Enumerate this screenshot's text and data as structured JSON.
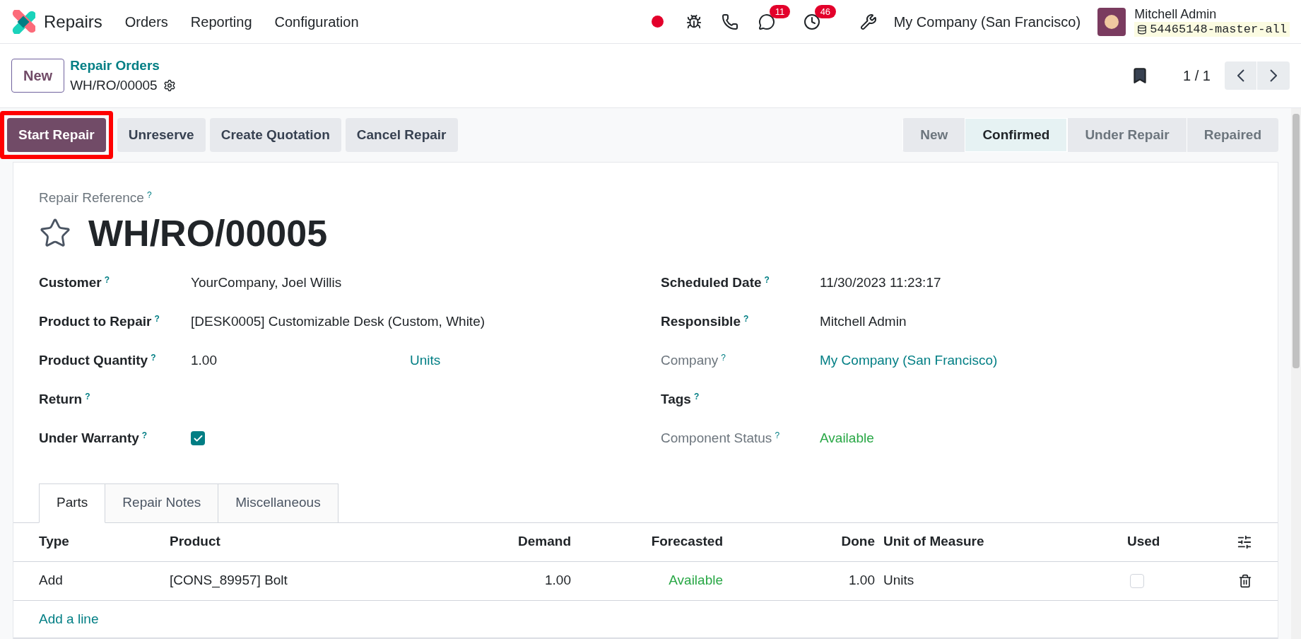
{
  "navbar": {
    "app_name": "Repairs",
    "menu": [
      "Orders",
      "Reporting",
      "Configuration"
    ],
    "badges": {
      "messages": "11",
      "activities": "46"
    },
    "company": "My Company (San Francisco)",
    "user": "Mitchell Admin",
    "database": "54465148-master-all"
  },
  "control_panel": {
    "new_button": "New",
    "breadcrumb": "Repair Orders",
    "record": "WH/RO/00005",
    "pager": "1 / 1"
  },
  "actions": [
    {
      "label": "Start Repair",
      "primary": true,
      "highlighted": true
    },
    {
      "label": "Unreserve",
      "primary": false,
      "highlighted": false
    },
    {
      "label": "Create Quotation",
      "primary": false,
      "highlighted": false
    },
    {
      "label": "Cancel Repair",
      "primary": false,
      "highlighted": false
    }
  ],
  "statusbar": [
    {
      "label": "New",
      "selected": false
    },
    {
      "label": "Confirmed",
      "selected": true
    },
    {
      "label": "Under Repair",
      "selected": false
    },
    {
      "label": "Repaired",
      "selected": false
    }
  ],
  "form": {
    "reference_label": "Repair Reference",
    "help": "?",
    "title": "WH/RO/00005",
    "starred": false,
    "left_fields": [
      {
        "label": "Customer",
        "kind": "text",
        "value": "YourCompany, Joel Willis",
        "muted": false
      },
      {
        "label": "Product to Repair",
        "kind": "text",
        "value": "[DESK0005] Customizable Desk (Custom, White)",
        "muted": false
      },
      {
        "label": "Product Quantity",
        "kind": "quantity",
        "value": "1.00",
        "unit": "Units",
        "muted": false
      },
      {
        "label": "Return",
        "kind": "text",
        "muted": false
      },
      {
        "label": "Under Warranty",
        "kind": "checkbox",
        "checked": true,
        "muted": false
      }
    ],
    "right_fields": [
      {
        "label": "Scheduled Date",
        "kind": "text",
        "value": "11/30/2023 11:23:17",
        "muted": false
      },
      {
        "label": "Responsible",
        "kind": "text",
        "value": "Mitchell Admin",
        "muted": false
      },
      {
        "label": "Company",
        "kind": "link",
        "value": "My Company (San Francisco)",
        "muted": true
      },
      {
        "label": "Tags",
        "kind": "text",
        "muted": false
      },
      {
        "label": "Component Status",
        "kind": "status",
        "value": "Available",
        "muted": true
      }
    ]
  },
  "tabs": [
    {
      "label": "Parts",
      "selected": true
    },
    {
      "label": "Repair Notes",
      "selected": false
    },
    {
      "label": "Miscellaneous",
      "selected": false
    }
  ],
  "table": {
    "columns": [
      "Type",
      "Product",
      "Demand",
      "Forecasted",
      "Done",
      "Unit of Measure",
      "Used"
    ],
    "rows": [
      {
        "type": "Add",
        "product": "[CONS_89957] Bolt",
        "demand": "1.00",
        "forecasted": "Available",
        "done": "1.00",
        "uom": "Units",
        "used": false
      }
    ],
    "add_line": "Add a line"
  }
}
